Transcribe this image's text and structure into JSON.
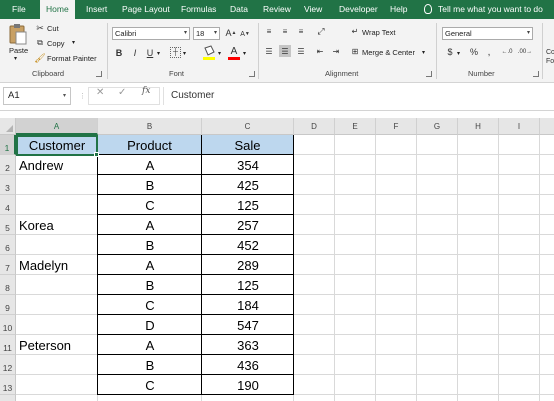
{
  "ribbon_tabs": [
    "File",
    "Home",
    "Insert",
    "Page Layout",
    "Formulas",
    "Data",
    "Review",
    "View",
    "Developer",
    "Help"
  ],
  "active_tab": "Home",
  "tell_me": "Tell me what you want to do",
  "clipboard": {
    "paste": "Paste",
    "cut": "Cut",
    "copy": "Copy",
    "format_painter": "Format Painter",
    "label": "Clipboard"
  },
  "font": {
    "name": "Calibri",
    "size": "18",
    "bold": "B",
    "italic": "I",
    "underline": "U",
    "color_letter": "A",
    "label": "Font",
    "fill_color": "#ffff00",
    "font_color": "#ff0000"
  },
  "alignment": {
    "wrap_text": "Wrap Text",
    "merge_center": "Merge & Center",
    "label": "Alignment"
  },
  "number": {
    "format": "General",
    "currency": "$",
    "percent": "%",
    "label": "Number"
  },
  "cond_fmt_partial": "Co\nFo",
  "formula_bar": {
    "name_box": "A1",
    "cancel": "✕",
    "enter": "✓",
    "fx": "fx",
    "formula": "Customer"
  },
  "columns": [
    "A",
    "B",
    "C",
    "D",
    "E",
    "F",
    "G",
    "H",
    "I"
  ],
  "rows": [
    "1",
    "2",
    "3",
    "4",
    "5",
    "6",
    "7",
    "8",
    "9",
    "10",
    "11",
    "12",
    "13"
  ],
  "table": {
    "headers": [
      "Customer",
      "Product",
      "Sale"
    ],
    "header_fill": "#bdd7ee",
    "rows": [
      [
        "Andrew",
        "A",
        "354"
      ],
      [
        "",
        "B",
        "425"
      ],
      [
        "",
        "C",
        "125"
      ],
      [
        "Korea",
        "A",
        "257"
      ],
      [
        "",
        "B",
        "452"
      ],
      [
        "Madelyn",
        "A",
        "289"
      ],
      [
        "",
        "B",
        "125"
      ],
      [
        "",
        "C",
        "184"
      ],
      [
        "",
        "D",
        "547"
      ],
      [
        "Peterson",
        "A",
        "363"
      ],
      [
        "",
        "B",
        "436"
      ],
      [
        "",
        "C",
        "190"
      ]
    ]
  },
  "accent": "#217346"
}
